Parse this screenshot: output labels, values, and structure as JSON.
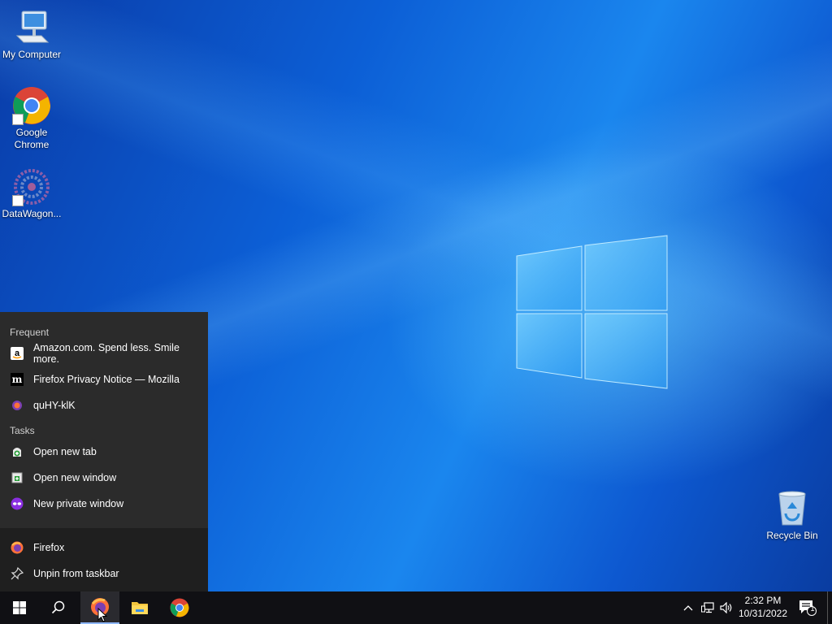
{
  "desktop": {
    "icons": [
      {
        "label": "My Computer"
      },
      {
        "label": "Google Chrome"
      },
      {
        "label": "DataWagon..."
      },
      {
        "label": "Recycle Bin"
      }
    ]
  },
  "jumplist": {
    "frequent_heading": "Frequent",
    "frequent": [
      {
        "label": "Amazon.com. Spend less. Smile more."
      },
      {
        "label": "Firefox Privacy Notice — Mozilla"
      },
      {
        "label": "quHY-klK"
      }
    ],
    "tasks_heading": "Tasks",
    "tasks": [
      {
        "label": "Open new tab"
      },
      {
        "label": "Open new window"
      },
      {
        "label": "New private window"
      }
    ],
    "app_label": "Firefox",
    "unpin_label": "Unpin from taskbar"
  },
  "taskbar": {
    "time": "2:32 PM",
    "date": "10/31/2022",
    "notification_count": "1"
  },
  "colors": {
    "taskbar_bg": "#101014",
    "jumplist_bg": "#2b2b2b",
    "accent": "#8fb8ff"
  }
}
